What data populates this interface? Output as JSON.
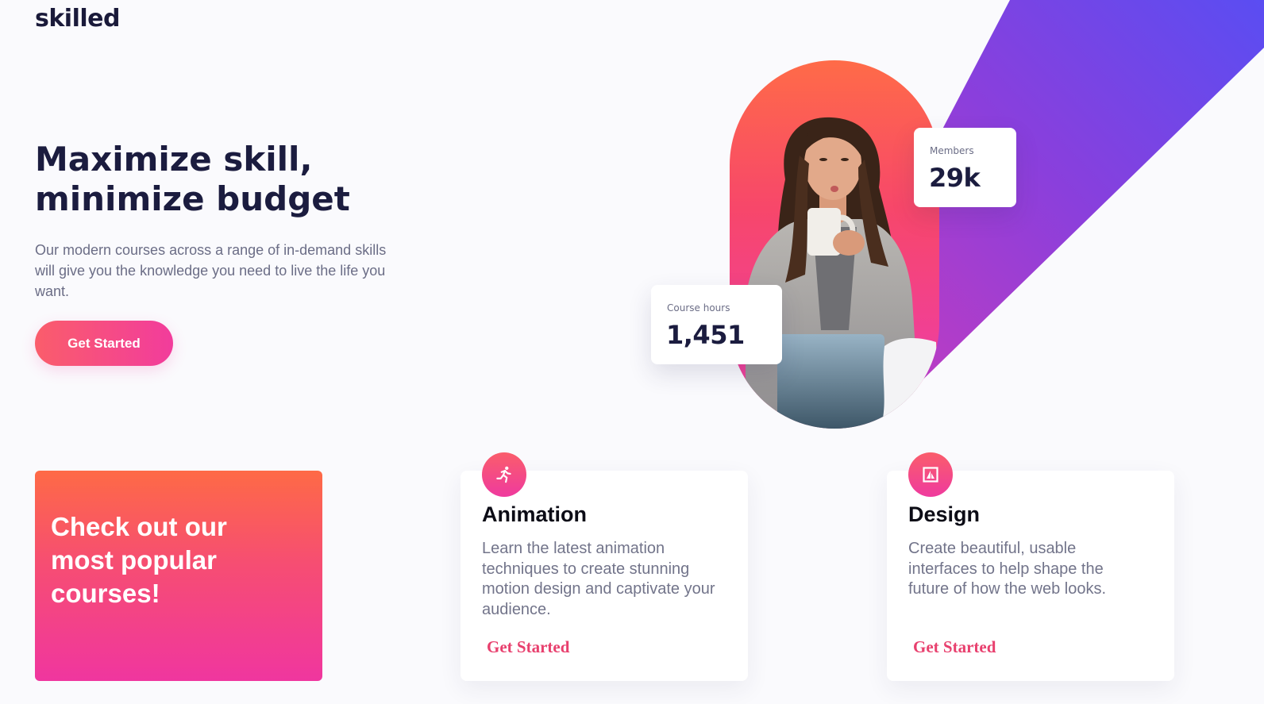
{
  "brand": {
    "logo_text": "skilled"
  },
  "hero": {
    "title_line1": "Maximize skill,",
    "title_line2": "minimize budget",
    "description": "Our modern courses across a range of in-demand skills will give you the knowledge you need to live the life you want.",
    "cta_label": "Get Started"
  },
  "stats": {
    "members": {
      "label": "Members",
      "value": "29k"
    },
    "course_hours": {
      "label": "Course hours",
      "value": "1,451"
    }
  },
  "promo": {
    "text": "Check out our most popular courses!"
  },
  "courses": [
    {
      "title": "Animation",
      "icon": "running-figure-icon",
      "description": "Learn the latest animation techniques to create stunning motion design and captivate your audience.",
      "link_label": "Get Started"
    },
    {
      "title": "Design",
      "icon": "design-frame-icon",
      "description": "Create beautiful, usable interfaces to help shape the future of how the web looks.",
      "link_label": "Get Started"
    }
  ],
  "colors": {
    "accent_start": "#fa5d6b",
    "accent_end": "#f23c9c",
    "stripe_start": "#a23ad6",
    "stripe_end": "#5a4df2",
    "heading": "#1b1c3f",
    "body_text": "#6b6d86",
    "link": "#e8406e"
  }
}
